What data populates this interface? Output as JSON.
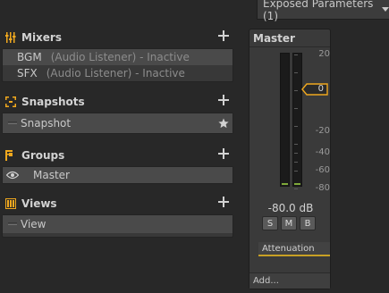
{
  "topbar": {
    "exposed_label": "Exposed Parameters (1)"
  },
  "mixers": {
    "title": "Mixers",
    "items": [
      {
        "name": "BGM",
        "detail": "(Audio Listener) - Inactive"
      },
      {
        "name": "SFX",
        "detail": "(Audio Listener) - Inactive"
      }
    ]
  },
  "snapshots": {
    "title": "Snapshots",
    "items": [
      {
        "name": "Snapshot"
      }
    ]
  },
  "groups": {
    "title": "Groups",
    "items": [
      {
        "name": "Master"
      }
    ]
  },
  "views": {
    "title": "Views",
    "items": [
      {
        "name": "View"
      }
    ]
  },
  "strip": {
    "title": "Master",
    "scale": [
      "20",
      "0",
      "-20",
      "-40",
      "-60",
      "-80"
    ],
    "fader_value": "0",
    "db_readout": "-80.0 dB",
    "solo": "S",
    "mute": "M",
    "bypass": "B",
    "effect": "Attenuation",
    "add_label": "Add..."
  },
  "colors": {
    "accent": "#f0a81e",
    "meter_level": "#7ea83a"
  }
}
